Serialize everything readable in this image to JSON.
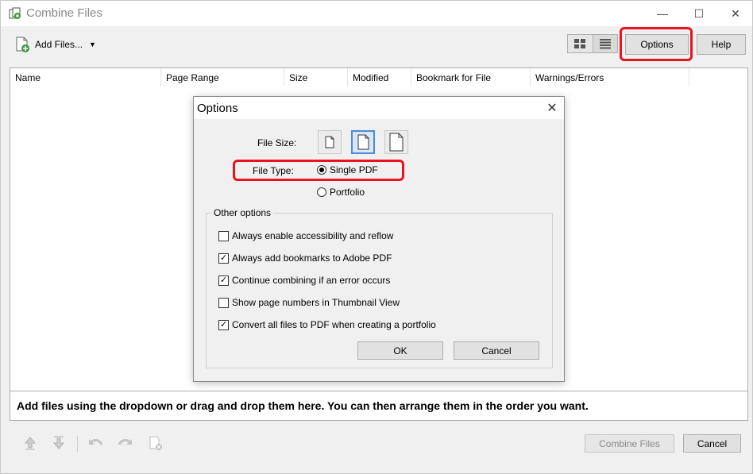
{
  "window": {
    "title": "Combine Files",
    "controls": {
      "minimize": "—",
      "maximize": "☐",
      "close": "✕"
    }
  },
  "toolbar": {
    "add_files_label": "Add Files...",
    "options_label": "Options",
    "help_label": "Help",
    "view_modes": [
      "thumbnail-view-icon",
      "list-view-icon"
    ],
    "active_view": "list-view-icon"
  },
  "file_list": {
    "columns": [
      "Name",
      "Page Range",
      "Size",
      "Modified",
      "Bookmark for File",
      "Warnings/Errors"
    ],
    "rows": [],
    "drop_hint": "Add files using the dropdown or drag and drop them here. You can then arrange them in the order you want."
  },
  "bottom_bar": {
    "icons": [
      "move-up-icon",
      "move-down-icon",
      "undo-icon",
      "redo-icon",
      "remove-file-icon"
    ],
    "combine_label": "Combine Files",
    "combine_disabled": true,
    "cancel_label": "Cancel"
  },
  "options_dialog": {
    "title": "Options",
    "file_size_label": "File Size:",
    "file_size_options": [
      "small-page-icon",
      "medium-page-icon",
      "large-page-icon"
    ],
    "file_size_selected": 1,
    "file_type_label": "File Type:",
    "file_type_options": [
      "Single PDF",
      "Portfolio"
    ],
    "file_type_selected": "Single PDF",
    "other_options_label": "Other options",
    "checkboxes": [
      {
        "label": "Always enable accessibility and reflow",
        "checked": false
      },
      {
        "label": "Always add bookmarks to Adobe PDF",
        "checked": true
      },
      {
        "label": "Continue combining if an error occurs",
        "checked": true
      },
      {
        "label": "Show page numbers in Thumbnail View",
        "checked": false
      },
      {
        "label": "Convert all files to PDF when creating a portfolio",
        "checked": true
      }
    ],
    "ok_label": "OK",
    "cancel_label": "Cancel"
  },
  "highlight_color": "#e8131e"
}
